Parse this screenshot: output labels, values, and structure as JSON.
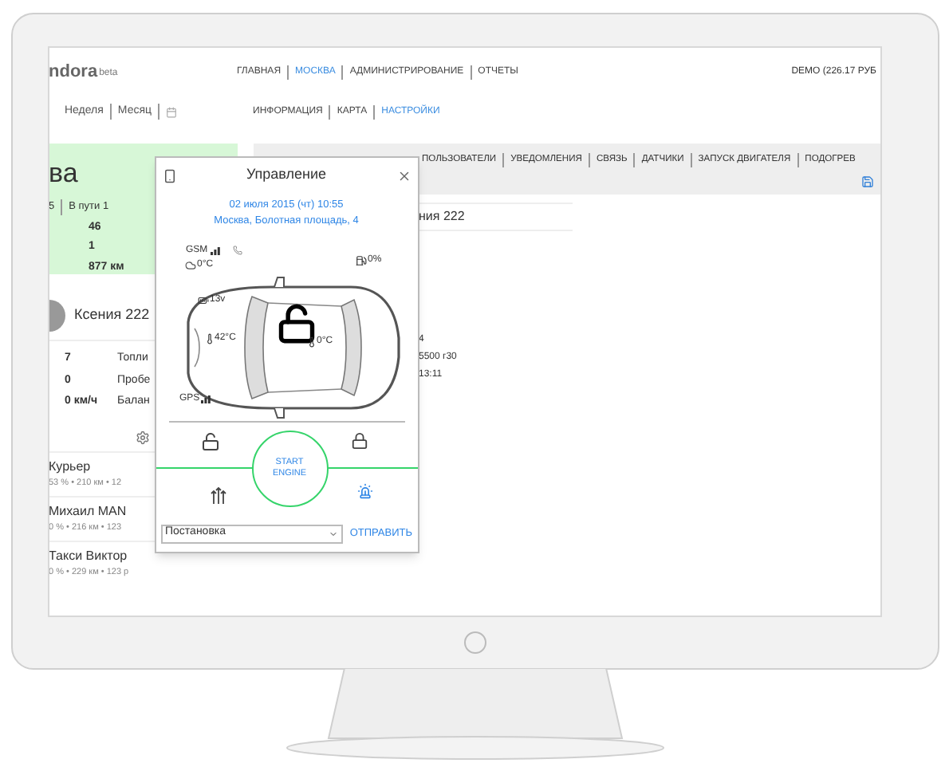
{
  "header": {
    "logo": "ndora",
    "logo_suffix": "beta",
    "nav": [
      {
        "label": "ГЛАВНАЯ",
        "selected": false
      },
      {
        "label": "МОСКВА",
        "selected": true
      },
      {
        "label": "АДМИНИСТРИРОВАНИЕ",
        "selected": false
      },
      {
        "label": "ОТЧЕТЫ",
        "selected": false
      }
    ],
    "account": "DEMO (226.17 РУБ"
  },
  "period_tabs": [
    "Неделя",
    "Месяц"
  ],
  "subnav": [
    {
      "label": "ИНФОРМАЦИЯ",
      "selected": false
    },
    {
      "label": "КАРТА",
      "selected": false
    },
    {
      "label": "НАСТРОЙКИ",
      "selected": true
    }
  ],
  "summary": {
    "title": "ва",
    "stats": [
      "5",
      "В пути 1"
    ],
    "values": [
      "46",
      "1",
      "877 км"
    ]
  },
  "vehicle": {
    "name": "Ксения 222",
    "rows": [
      {
        "value": "7",
        "label": "Топли"
      },
      {
        "value": "0",
        "label": "Пробе"
      },
      {
        "value": "0 км/ч",
        "label": "Балан"
      }
    ]
  },
  "vehicle_list": [
    {
      "name": "Курьер",
      "details": "53 % • 210 км • 12"
    },
    {
      "name": "Михаил MAN",
      "details": "0 % • 216 км • 123"
    },
    {
      "name": "Такси Виктор",
      "details": "0 % • 229 км • 123 р"
    }
  ],
  "settings_tabs": [
    "ПОЛЬЗОВАТЕЛИ",
    "УВЕДОМЛЕНИЯ",
    "СВЯЗЬ",
    "ДАТЧИКИ",
    "ЗАПУСК ДВИГАТЕЛЯ",
    "ПОДОГРЕВ"
  ],
  "details": {
    "name": "ния 222",
    "lines": [
      "4",
      "5500 г30",
      "13:11"
    ]
  },
  "control_dialog": {
    "title": "Управление",
    "date": "02 июля 2015 (чт) 10:55",
    "address": "Москва, Болотная площадь, 4",
    "gsm": "GSM",
    "outside_temp": "0°C",
    "fuel": "0%",
    "voltage": "13v",
    "engine_temp": "42°C",
    "cabin_temp": "0°C",
    "gps": "GPS",
    "locked": false,
    "start_button": "START ENGINE",
    "command": "Постановка",
    "send": "ОТПРАВИТЬ"
  }
}
